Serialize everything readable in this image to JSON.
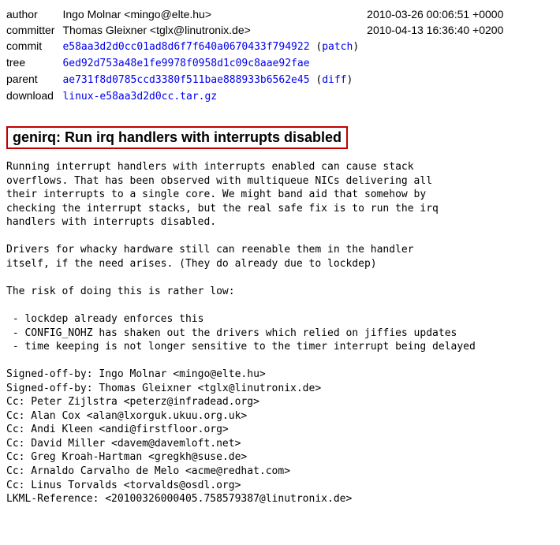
{
  "meta": {
    "author_label": "author",
    "author_name": "Ingo Molnar <mingo@elte.hu>",
    "author_date": "2010-03-26 00:06:51 +0000",
    "committer_label": "committer",
    "committer_name": "Thomas Gleixner <tglx@linutronix.de>",
    "committer_date": "2010-04-13 16:36:40 +0200",
    "commit_label": "commit",
    "commit_hash": "e58aa3d2d0cc01ad8d6f7f640a0670433f794922",
    "patch_label": "patch",
    "tree_label": "tree",
    "tree_hash": "6ed92d753a48e1fe9978f0958d1c09c8aae92fae",
    "parent_label": "parent",
    "parent_hash": "ae731f8d0785ccd3380f511bae888933b6562e45",
    "diff_label": "diff",
    "download_label": "download",
    "download_file": "linux-e58aa3d2d0cc.tar.gz",
    "open_paren": " (",
    "close_paren": ")"
  },
  "title": "genirq: Run irq handlers with interrupts disabled",
  "body": "Running interrupt handlers with interrupts enabled can cause stack\noverflows. That has been observed with multiqueue NICs delivering all\ntheir interrupts to a single core. We might band aid that somehow by\nchecking the interrupt stacks, but the real safe fix is to run the irq\nhandlers with interrupts disabled.\n\nDrivers for whacky hardware still can reenable them in the handler\nitself, if the need arises. (They do already due to lockdep)\n\nThe risk of doing this is rather low:\n\n - lockdep already enforces this\n - CONFIG_NOHZ has shaken out the drivers which relied on jiffies updates\n - time keeping is not longer sensitive to the timer interrupt being delayed\n\nSigned-off-by: Ingo Molnar <mingo@elte.hu>\nSigned-off-by: Thomas Gleixner <tglx@linutronix.de>\nCc: Peter Zijlstra <peterz@infradead.org>\nCc: Alan Cox <alan@lxorguk.ukuu.org.uk>\nCc: Andi Kleen <andi@firstfloor.org>\nCc: David Miller <davem@davemloft.net>\nCc: Greg Kroah-Hartman <gregkh@suse.de>\nCc: Arnaldo Carvalho de Melo <acme@redhat.com>\nCc: Linus Torvalds <torvalds@osdl.org>\nLKML-Reference: <20100326000405.758579387@linutronix.de>"
}
